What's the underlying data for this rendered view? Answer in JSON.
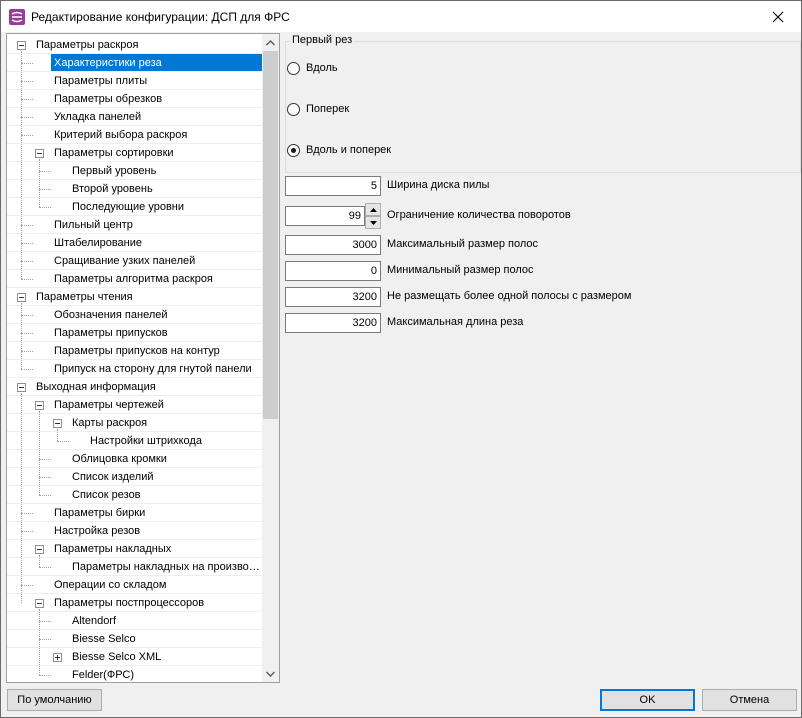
{
  "window": {
    "title": "Редактирование конфигурации: ДСП для ФРС",
    "colors": {
      "selection": "#0078d7",
      "accent_icon": "#9b3a9b"
    }
  },
  "tree": {
    "items": [
      {
        "label": "Параметры раскроя",
        "level": 0,
        "toggle": "minus"
      },
      {
        "label": "Характеристики реза",
        "level": 1,
        "selected": true
      },
      {
        "label": "Параметры плиты",
        "level": 1
      },
      {
        "label": "Параметры обрезков",
        "level": 1
      },
      {
        "label": "Укладка панелей",
        "level": 1
      },
      {
        "label": "Критерий выбора раскроя",
        "level": 1
      },
      {
        "label": "Параметры сортировки",
        "level": 1,
        "toggle": "minus"
      },
      {
        "label": "Первый уровень",
        "level": 2
      },
      {
        "label": "Второй уровень",
        "level": 2
      },
      {
        "label": "Последующие уровни",
        "level": 2
      },
      {
        "label": "Пильный центр",
        "level": 1
      },
      {
        "label": "Штабелирование",
        "level": 1
      },
      {
        "label": "Сращивание узких панелей",
        "level": 1
      },
      {
        "label": "Параметры алгоритма раскроя",
        "level": 1
      },
      {
        "label": "Параметры чтения",
        "level": 0,
        "toggle": "minus"
      },
      {
        "label": "Обозначения панелей",
        "level": 1
      },
      {
        "label": "Параметры припусков",
        "level": 1
      },
      {
        "label": "Параметры припусков на контур",
        "level": 1
      },
      {
        "label": "Припуск на сторону для гнутой панели",
        "level": 1
      },
      {
        "label": "Выходная информация",
        "level": 0,
        "toggle": "minus"
      },
      {
        "label": "Параметры чертежей",
        "level": 1,
        "toggle": "minus"
      },
      {
        "label": "Карты раскроя",
        "level": 2,
        "toggle": "minus"
      },
      {
        "label": "Настройки штрихкода",
        "level": 3
      },
      {
        "label": "Облицовка кромки",
        "level": 2
      },
      {
        "label": "Список изделий",
        "level": 2
      },
      {
        "label": "Список резов",
        "level": 2
      },
      {
        "label": "Параметры бирки",
        "level": 1
      },
      {
        "label": "Настройка резов",
        "level": 1
      },
      {
        "label": "Параметры накладных",
        "level": 1,
        "toggle": "minus"
      },
      {
        "label": "Параметры накладных на произво…",
        "level": 2
      },
      {
        "label": "Операции со складом",
        "level": 1
      },
      {
        "label": "Параметры постпроцессоров",
        "level": 1,
        "toggle": "minus"
      },
      {
        "label": "Altendorf",
        "level": 2
      },
      {
        "label": "Biesse Selco",
        "level": 2
      },
      {
        "label": "Biesse Selco XML",
        "level": 2,
        "toggle": "plus"
      },
      {
        "label": "Felder(ФРС)",
        "level": 2
      }
    ]
  },
  "first_cut": {
    "group_title": "Первый рез",
    "options": [
      {
        "label": "Вдоль",
        "checked": false
      },
      {
        "label": "Поперек",
        "checked": false
      },
      {
        "label": "Вдоль и поперек",
        "checked": true
      }
    ]
  },
  "fields": [
    {
      "value": "5",
      "label": "Ширина диска пилы",
      "spin": false
    },
    {
      "value": "99",
      "label": "Ограничение количества поворотов",
      "spin": true
    },
    {
      "value": "3000",
      "label": "Максимальный размер полос",
      "spin": false
    },
    {
      "value": "0",
      "label": "Минимальный размер полос",
      "spin": false
    },
    {
      "value": "3200",
      "label": "Не размещать более одной полосы с размером",
      "spin": false
    },
    {
      "value": "3200",
      "label": "Максимальная длина реза",
      "spin": false
    }
  ],
  "buttons": {
    "defaults": "По умолчанию",
    "ok": "OK",
    "cancel": "Отмена"
  }
}
